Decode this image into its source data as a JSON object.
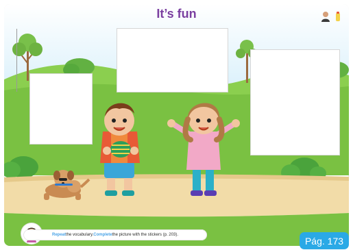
{
  "page": {
    "title": "It’s fun",
    "page_badge": "Pág. 173"
  },
  "instruction": {
    "verb1": "Repeat",
    "text1": " the vocabulary. ",
    "verb2": "Complete",
    "text2": " the picture with the stickers (p. 203)."
  },
  "colors": {
    "title": "#7a3fa0",
    "badge": "#2aa9e6",
    "sky": "#d9f0fb",
    "grass": "#7ac142",
    "path": "#f2dca8"
  }
}
